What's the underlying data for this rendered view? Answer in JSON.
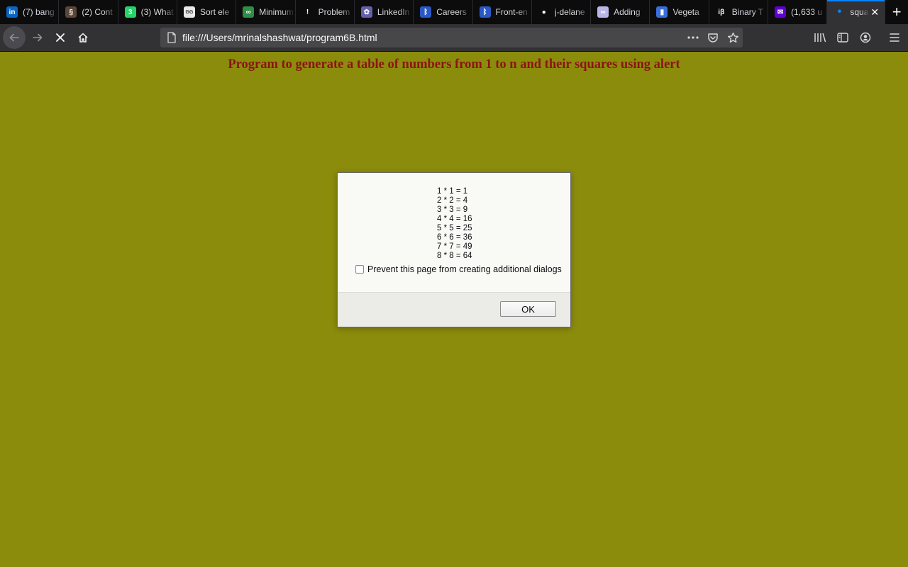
{
  "tabs": [
    {
      "title": "(7) bang",
      "icon": "linkedin-icon",
      "color": "#0a66c2",
      "glyph": "in"
    },
    {
      "title": "(2) Cont",
      "icon": "codechef-icon",
      "color": "#5b4638",
      "glyph": "§"
    },
    {
      "title": "(3) What",
      "icon": "whatsapp-icon",
      "color": "#25d366",
      "glyph": "3"
    },
    {
      "title": "Sort ele",
      "icon": "geeksforgeeks-icon",
      "color": "#e8e8e8",
      "glyph": "GG"
    },
    {
      "title": "Minimum",
      "icon": "gfg-icon",
      "color": "#2f8d46",
      "glyph": "∞"
    },
    {
      "title": "Problem",
      "icon": "warning-icon",
      "color": "#0c0c0d",
      "glyph": "!"
    },
    {
      "title": "LinkedIn",
      "icon": "nbc-icon",
      "color": "#6460aa",
      "glyph": "✿"
    },
    {
      "title": "Careers",
      "icon": "bluetooth-icon",
      "color": "#2a58c6",
      "glyph": "ᛒ"
    },
    {
      "title": "Front-en",
      "icon": "bluetooth-icon",
      "color": "#2a58c6",
      "glyph": "ᛒ"
    },
    {
      "title": "j-delane",
      "icon": "github-icon",
      "color": "#0c0c0d",
      "glyph": "●"
    },
    {
      "title": "Adding",
      "icon": "binoculars-icon",
      "color": "#b9b5e8",
      "glyph": "∞"
    },
    {
      "title": "Vegeta",
      "icon": "chart-icon",
      "color": "#3a6ed8",
      "glyph": "▮"
    },
    {
      "title": "Binary T",
      "icon": "interviewbit-icon",
      "color": "#0c0c0d",
      "glyph": "iβ"
    },
    {
      "title": "(1,633 u",
      "icon": "yahoo-mail-icon",
      "color": "#6001d2",
      "glyph": "✉"
    },
    {
      "title": "squa",
      "icon": "page-icon",
      "color": "#0a84ff",
      "glyph": "•",
      "active": true
    }
  ],
  "urlbar": {
    "url": "file:///Users/mrinalshashwat/program6B.html"
  },
  "page": {
    "heading": "Program to generate a table of numbers from 1 to n and their squares using alert"
  },
  "dialog": {
    "lines": [
      "1 * 1 = 1",
      "2 * 2 = 4",
      "3 * 3 = 9",
      "4 * 4 = 16",
      "5 * 5 = 25",
      "6 * 6 = 36",
      "7 * 7 = 49",
      "8 * 8 = 64"
    ],
    "prevent_label": "Prevent this page from creating additional dialogs",
    "prevent_checked": false,
    "ok_label": "OK"
  }
}
